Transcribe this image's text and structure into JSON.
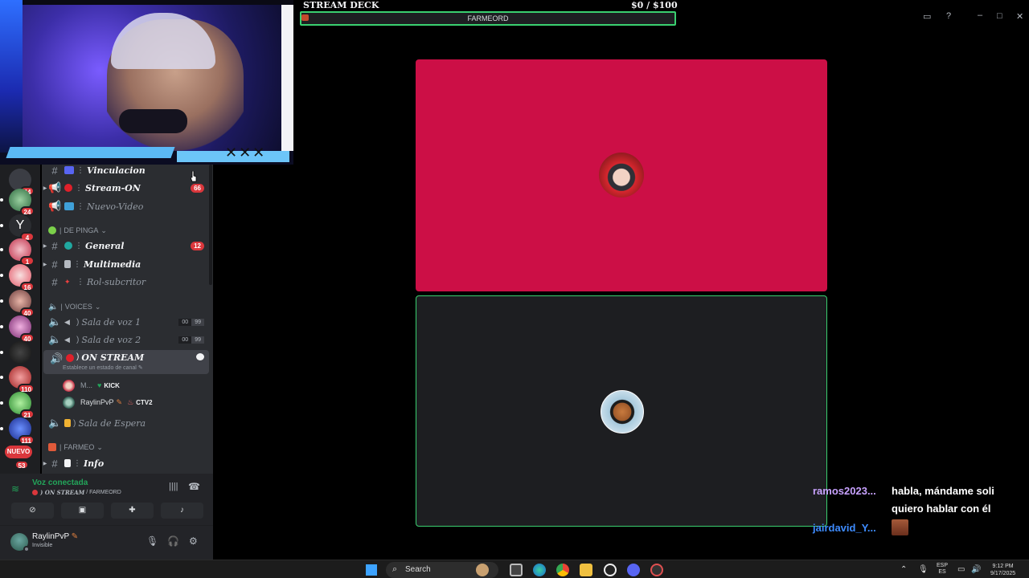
{
  "stream_overlay": {
    "deck_title": "STREAM DECK",
    "money": "$0   / $100",
    "farm_bar_label": "FARMEORD"
  },
  "servers": [
    {
      "badge": "44"
    },
    {
      "badge": "24"
    },
    {
      "badge": "4"
    },
    {
      "badge": "1"
    },
    {
      "badge": "16"
    },
    {
      "badge": "40"
    },
    {
      "badge": "40"
    },
    {
      "badge": ""
    },
    {
      "badge": "110"
    },
    {
      "badge": "21"
    },
    {
      "badge": "111"
    },
    {
      "new_label": "NUEVO",
      "badge": "53"
    }
  ],
  "channels": {
    "vinculacion": "Vinculacion",
    "stream_on": "Stream-ON",
    "stream_on_count": "66",
    "nuevo_video": "Nuevo-Video",
    "cat_de_pinga": "DE PINGA",
    "general": "General",
    "general_count": "12",
    "multimedia": "Multimedia",
    "rol_subcritor": "Rol-subcritor",
    "cat_voices": "VOICES",
    "sala1": "Sala de voz 1",
    "sala2": "Sala de voz 2",
    "sala_users_a": "00",
    "sala_users_b": "99",
    "on_stream": "ON STREAM",
    "on_stream_status": "Establece un estado de canal",
    "voice_user1": "M...",
    "voice_user1_tag": "KICK",
    "voice_user2": "RaylinPvP",
    "voice_user2_tag": "CTV2",
    "sala_espera": "Sala de Espera",
    "cat_farmeo": "FARMEO",
    "info": "Info"
  },
  "voice_panel": {
    "title": "Voz conectada",
    "channel": "ON STREAM",
    "server": "/ FARMEORD"
  },
  "user_panel": {
    "name": "RaylinPvP",
    "status": "Invisible"
  },
  "chat": [
    {
      "user": "ramos2023...",
      "message_line1": "habla, mándame soli",
      "message_line2": "quiero hablar con él"
    },
    {
      "user": "jairdavid_Y..."
    }
  ],
  "taskbar": {
    "search": "Search",
    "lang_top": "ESP",
    "lang_bottom": "ES",
    "time": "9:12 PM",
    "date": "9/17/2025"
  },
  "colors": {
    "discord_bg": "#2b2d31",
    "rail_bg": "#1e1f22",
    "tile_top": "#cc0f46",
    "accent_green": "#3ad070",
    "badge_red": "#da373c",
    "chat_user1": "#c8a2ff",
    "chat_user2": "#3e8cff"
  }
}
